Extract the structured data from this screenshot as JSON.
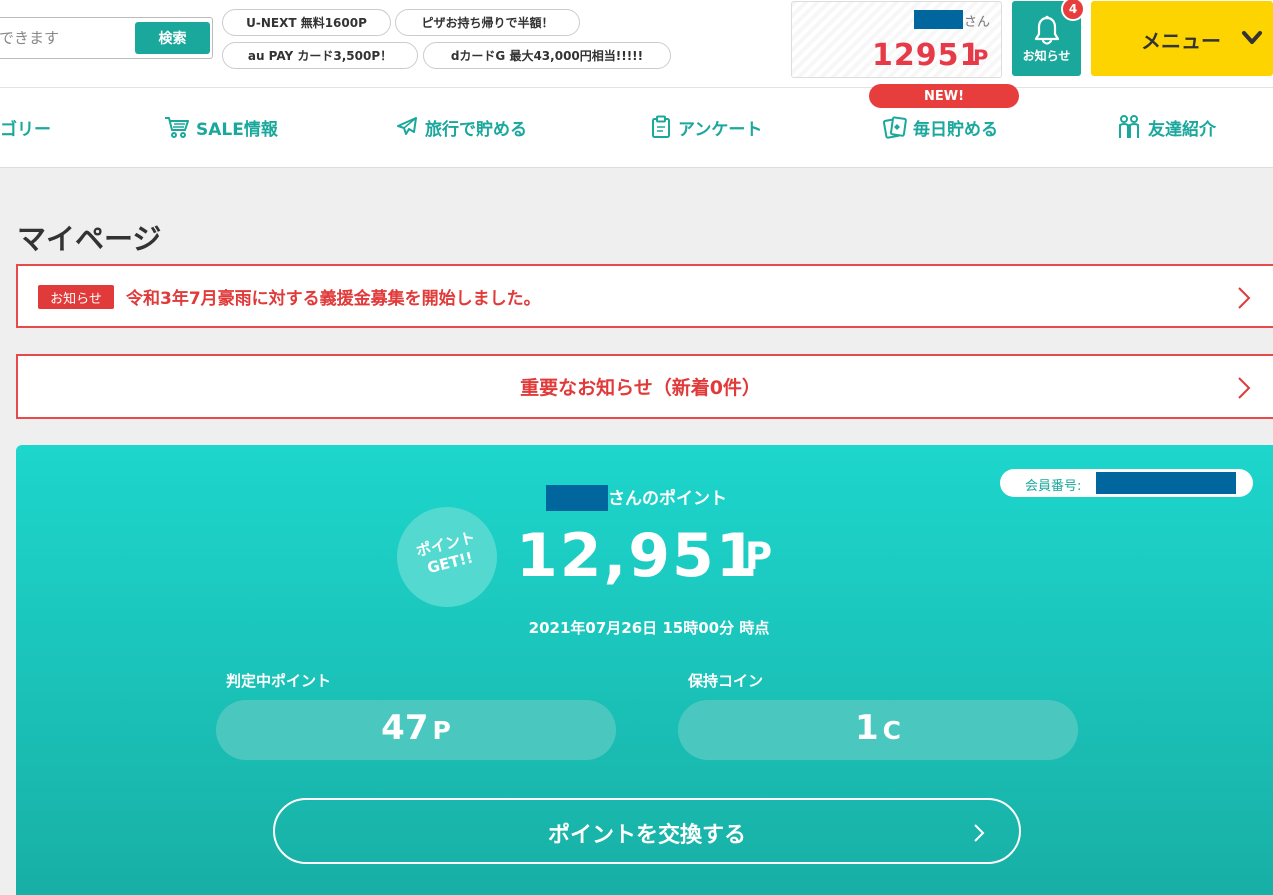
{
  "header": {
    "search": {
      "placeholder": "できます",
      "button_label": "検索"
    },
    "promos": [
      {
        "label": "U-NEXT 無料1600P"
      },
      {
        "label": "ピザお持ち帰りで半額！"
      },
      {
        "label": "au PAY カード3,500P！"
      },
      {
        "label": "dカードG 最大43,000円相当!!!!!"
      }
    ],
    "user": {
      "honorific": "さん",
      "points": "12951",
      "points_unit": "P"
    },
    "notifications": {
      "label": "お知らせ",
      "count": "4",
      "icon": "bell-icon"
    },
    "menu": {
      "label": "メニュー",
      "icon": "chevron-down-icon"
    }
  },
  "nav": {
    "items": [
      {
        "label": "ゴリー",
        "icon": ""
      },
      {
        "label": "SALE情報",
        "icon": "cart-icon"
      },
      {
        "label": "旅行で貯める",
        "icon": "airplane-icon"
      },
      {
        "label": "アンケート",
        "icon": "clipboard-icon"
      },
      {
        "label": "毎日貯める",
        "icon": "cards-icon"
      },
      {
        "label": "友達紹介",
        "icon": "friends-icon"
      }
    ],
    "new_badge": "NEW!"
  },
  "main": {
    "title": "マイページ",
    "notice": {
      "tag": "お知らせ",
      "text": "令和3年7月豪雨に対する義援金募集を開始しました。"
    },
    "important": {
      "text": "重要なお知らせ（新着0件）"
    },
    "points_card": {
      "member_label": "会員番号:",
      "owner_suffix": "さんのポイント",
      "get_badge_line1": "ポイント",
      "get_badge_line2": "GET!!",
      "total": "12,951",
      "total_unit": "P",
      "as_of": "2021年07月26日 15時00分 時点",
      "pending": {
        "label": "判定中ポイント",
        "value": "47",
        "unit": "P"
      },
      "coins": {
        "label": "保持コイン",
        "value": "1",
        "unit": "C"
      },
      "exchange_button": "ポイントを交換する"
    }
  },
  "colors": {
    "accent": "#1aa89c",
    "alert": "#e03a3a",
    "menu": "#fdd400",
    "redaction": "#01659e"
  }
}
